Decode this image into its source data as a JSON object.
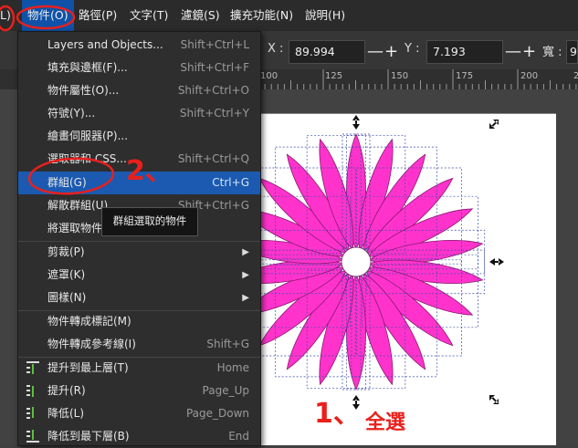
{
  "menubar": {
    "items": [
      {
        "label": "L)"
      },
      {
        "label": "物件(O)"
      },
      {
        "label": "路徑(P)"
      },
      {
        "label": "文字(T)"
      },
      {
        "label": "濾鏡(S)"
      },
      {
        "label": "擴充功能(N)"
      },
      {
        "label": "說明(H)"
      }
    ]
  },
  "toolbar": {
    "x_label": "X :",
    "x_value": "89.994",
    "y_label": "Y :",
    "y_value": "7.193",
    "w_label": "寬 :",
    "w_value": "9",
    "minus": "—",
    "plus": "+"
  },
  "ruler": {
    "ticks": [
      "100",
      "125",
      "150",
      "175",
      "200",
      "225"
    ]
  },
  "object_menu": {
    "items": [
      {
        "label": "Layers and Objects...",
        "shortcut": "Shift+Ctrl+L"
      },
      {
        "label": "填充與邊框(F)...",
        "shortcut": "Shift+Ctrl+F"
      },
      {
        "label": "物件屬性(O)...",
        "shortcut": "Shift+Ctrl+O"
      },
      {
        "label": "符號(Y)...",
        "shortcut": "Shift+Ctrl+Y"
      },
      {
        "label": "繪畫伺服器(P)...",
        "shortcut": ""
      },
      {
        "label": "選取器和 CSS...",
        "shortcut": "Shift+Ctrl+Q"
      },
      {
        "label": "群組(G)",
        "shortcut": "Ctrl+G"
      },
      {
        "label": "解散群組(U)",
        "shortcut": "Shift+Ctrl+G"
      },
      {
        "label": "將選取物件...脫離群組(P)",
        "shortcut": ""
      },
      {
        "label": "剪裁(P)",
        "shortcut": ""
      },
      {
        "label": "遮罩(K)",
        "shortcut": ""
      },
      {
        "label": "圖樣(N)",
        "shortcut": ""
      },
      {
        "label": "物件轉成標記(M)",
        "shortcut": ""
      },
      {
        "label": "物件轉成參考線(I)",
        "shortcut": "Shift+G"
      },
      {
        "label": "提升到最上層(T)",
        "shortcut": "Home"
      },
      {
        "label": "提升(R)",
        "shortcut": "Page_Up"
      },
      {
        "label": "降低(L)",
        "shortcut": "Page_Down"
      },
      {
        "label": "降低到最下層(B)",
        "shortcut": "End"
      }
    ],
    "submenu_arrow": "▶"
  },
  "tooltip": {
    "text": "群組選取的物件"
  },
  "annotations": {
    "step1": "1、",
    "step1_text": "全選",
    "step2": "2、"
  },
  "colors": {
    "accent": "#1b5ab0",
    "petal": "#ff33cc",
    "annotation": "#e8201c"
  }
}
